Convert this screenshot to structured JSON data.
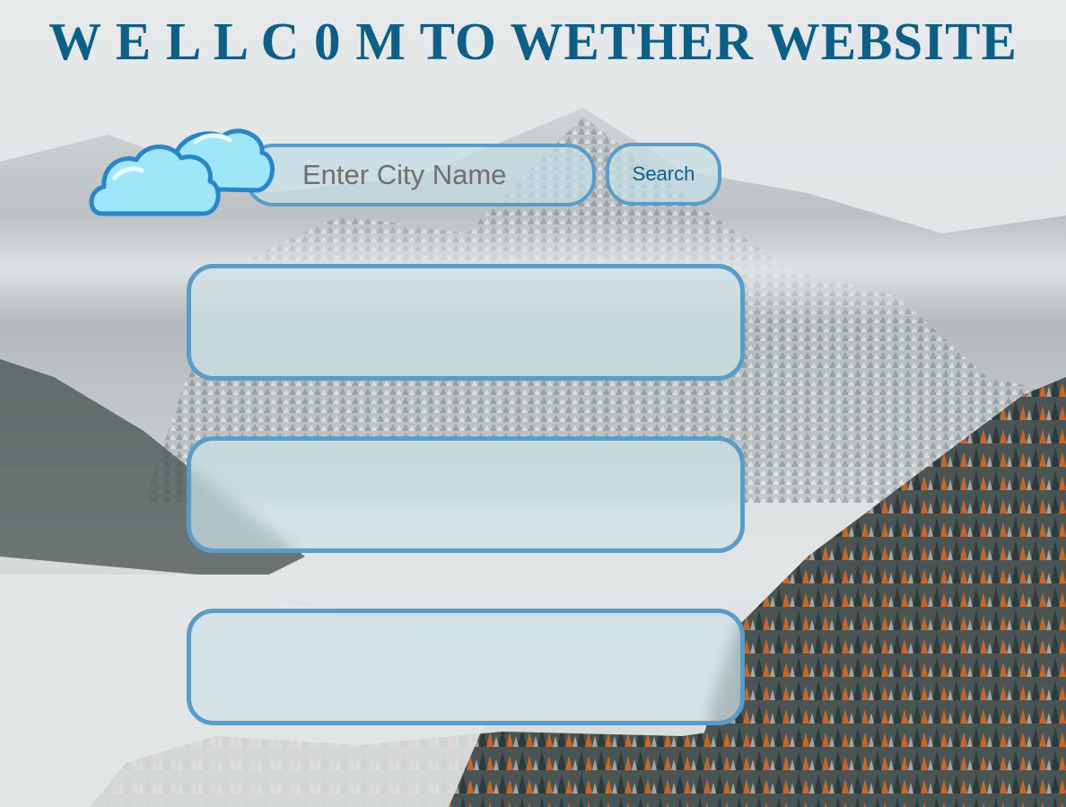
{
  "page": {
    "title": "W E L L C 0 M TO WETHER WEBSITE"
  },
  "search": {
    "placeholder": "Enter City Name",
    "value": "",
    "button_label": "Search"
  },
  "results": {
    "panel_1": "",
    "panel_2": "",
    "panel_3": ""
  },
  "icons": {
    "logo": "cloud-icon"
  },
  "colors": {
    "title": "#0d5f86",
    "border": "#5a9cc8",
    "panel_fill": "#cde2e8",
    "cloud_fill": "#9fe6f8",
    "cloud_stroke": "#2a86c8"
  }
}
